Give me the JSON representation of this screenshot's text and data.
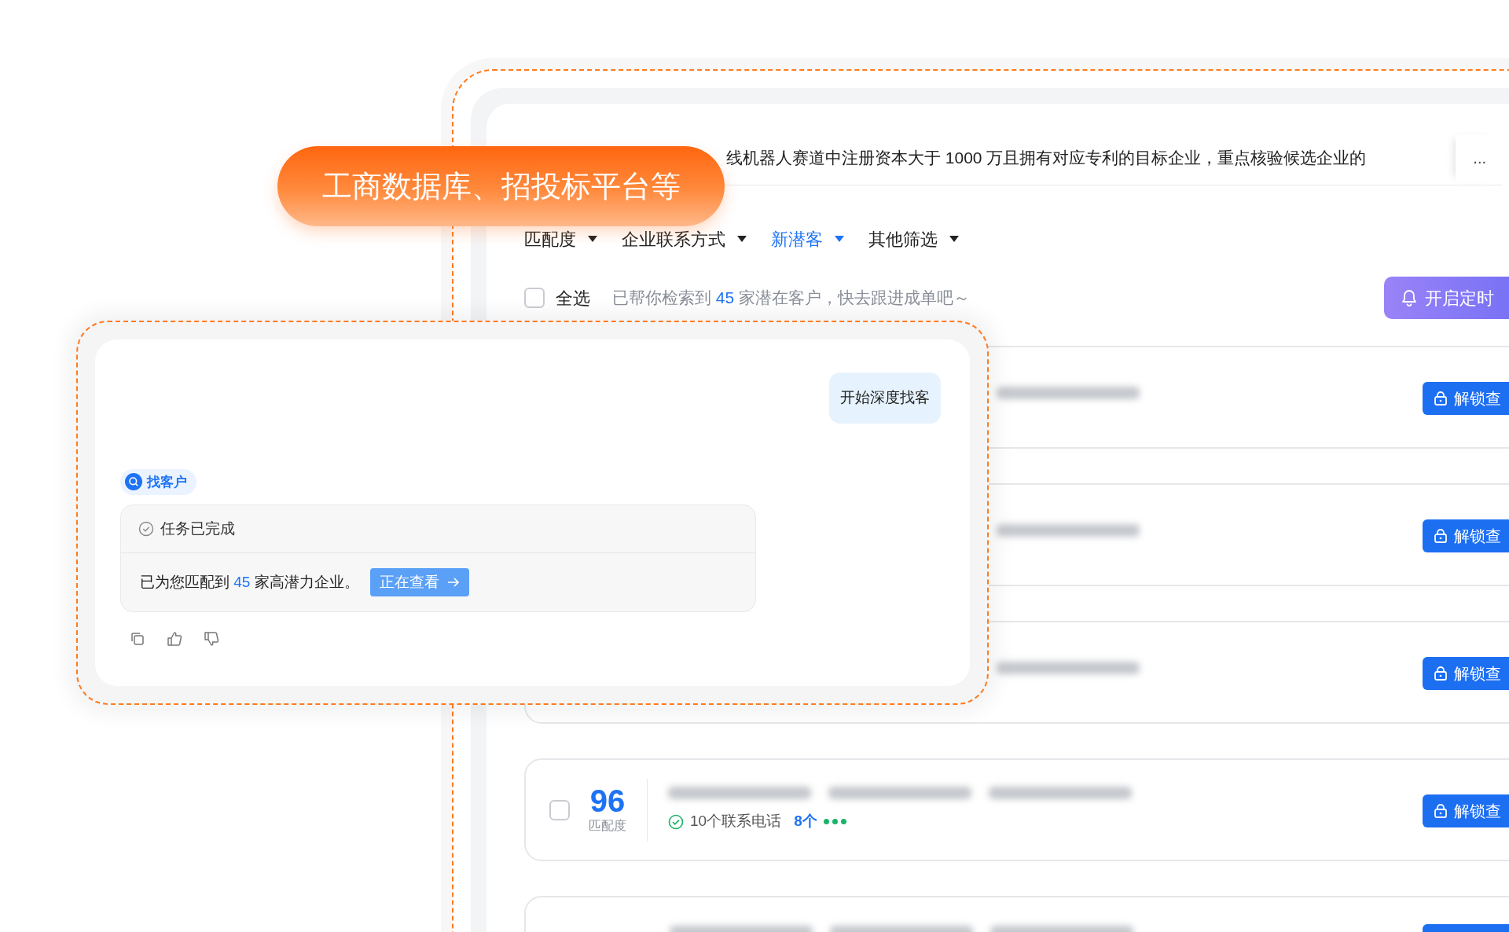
{
  "callout": {
    "text": "工商数据库、招投标平台等"
  },
  "main_window": {
    "query": "线机器人赛道中注册资本大于 1000 万且拥有对应专利的目标企业，重点核验候选企业的",
    "query_more": "...",
    "filters": [
      {
        "label": "匹配度",
        "selected": false
      },
      {
        "label": "企业联系方式",
        "selected": false
      },
      {
        "label": "新潜客",
        "selected": true
      },
      {
        "label": "其他筛选",
        "selected": false
      }
    ],
    "select_all": {
      "label": "全选",
      "checked": false
    },
    "summary": {
      "prefix": "已帮你检索到",
      "count": "45",
      "suffix": "家潜在客户，快去跟进成单吧～"
    },
    "schedule_button": "开启定时",
    "results": [
      {
        "kind": "covered",
        "button": "解锁查"
      },
      {
        "kind": "covered",
        "button": "解锁查"
      },
      {
        "kind": "covered",
        "button": "解锁查"
      },
      {
        "kind": "full",
        "checked": false,
        "score": "96",
        "score_label": "匹配度",
        "contact": "10个联系电话",
        "extra": "8个",
        "button": "解锁查"
      },
      {
        "kind": "cut"
      }
    ]
  },
  "chat": {
    "user_message": "开始深度找客",
    "tool_tag": "找客户",
    "status": "任务已完成",
    "result_prefix": "已为您匹配到",
    "result_count": "45",
    "result_suffix": "家高潜力企业。",
    "view_button": "正在查看"
  }
}
